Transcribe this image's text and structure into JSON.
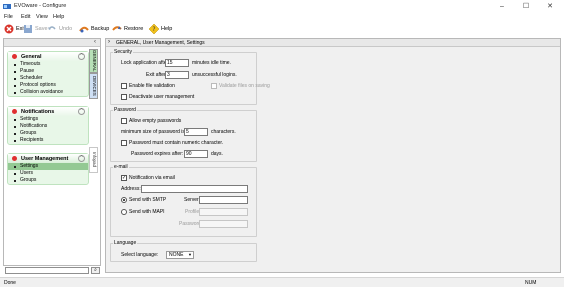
{
  "window": {
    "title": "EVOware - Configure",
    "controls": {
      "minimize": "–",
      "maximize": "☐",
      "close": "✕"
    }
  },
  "menu": [
    "File",
    "Edit",
    "View",
    "Help"
  ],
  "toolbar": {
    "exit": "Exit",
    "save": "Save",
    "undo": "Undo",
    "backup": "Backup",
    "restore": "Restore",
    "help": "Help"
  },
  "sidebar": {
    "vertical_tabs": [
      "GENERAL",
      "DEVICES",
      "Infopad"
    ],
    "groups": [
      {
        "title": "General",
        "items": [
          "Timeouts",
          "Pause",
          "Scheduler",
          "Protocol options",
          "Collision avoidance"
        ]
      },
      {
        "title": "Notifications",
        "items": [
          "Settings",
          "Notifications",
          "Groups",
          "Recipients"
        ]
      },
      {
        "title": "User Management",
        "items": [
          "Settings",
          "Users",
          "Groups"
        ],
        "active_item": 0
      }
    ]
  },
  "main": {
    "breadcrumb": "GENERAL, User Management, Settings",
    "security": {
      "legend": "Security",
      "lock_label": "Lock application after:",
      "lock_value": "15",
      "lock_unit": "minutes idle time.",
      "exit_label": "Exit after:",
      "exit_value": "3",
      "exit_unit": "unsuccessful logins.",
      "file_validation": "Enable file validation",
      "validate_on_saving": "Validate files on saving",
      "deactivate_um": "Deactivate user management"
    },
    "password": {
      "legend": "Password",
      "allow_empty": "Allow empty passwords",
      "min_size_label": "minimum size of password is",
      "min_size_value": "5",
      "min_size_unit": "characters.",
      "numeric_char": "Password must contain numeric character.",
      "expires_label": "Password expires after:",
      "expires_value": "90",
      "expires_unit": "days."
    },
    "email": {
      "legend": "e-mail",
      "notification": "Notification via email",
      "address_label": "Address:",
      "address_value": "",
      "smtp": "Send with SMTP",
      "server_label": "Server:",
      "server_value": "",
      "mapi": "Send with MAPI",
      "profile_label": "Profile:",
      "password_label": "Password:"
    },
    "language": {
      "legend": "Language",
      "select_label": "Select language:",
      "selected": "NONE"
    }
  },
  "status": {
    "left": "Done",
    "num": "NUM"
  },
  "colors": {
    "accent_green": "#93c993",
    "group_bg": "#e8f7e8",
    "tab_blue": "#cfe0f5",
    "icon_red": "#e03030"
  }
}
